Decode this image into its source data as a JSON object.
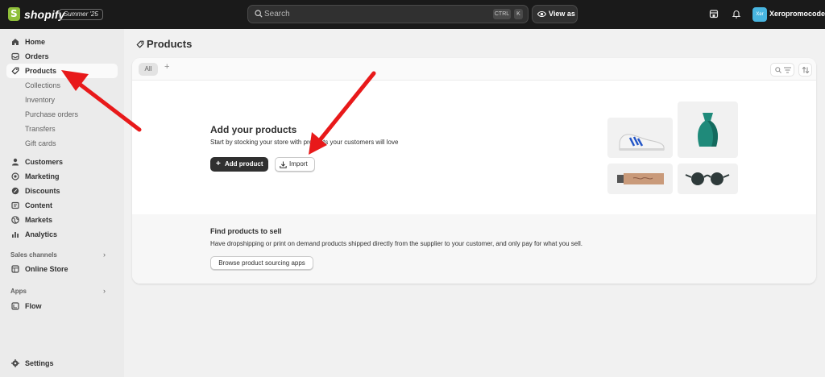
{
  "topbar": {
    "brand": "shopify",
    "edition_badge": "Summer '25",
    "search_placeholder": "Search",
    "shortcut_ctrl": "CTRL",
    "shortcut_k": "K",
    "view_as": "View as",
    "avatar_initials": "Xer",
    "store_name": "Xeropromocode",
    "avatar_color": "#48b5e0"
  },
  "sidebar": {
    "items": [
      {
        "label": "Home",
        "icon": "home-icon"
      },
      {
        "label": "Orders",
        "icon": "inbox-icon"
      },
      {
        "label": "Products",
        "icon": "tag-icon",
        "active": true
      }
    ],
    "product_subitems": [
      "Collections",
      "Inventory",
      "Purchase orders",
      "Transfers",
      "Gift cards"
    ],
    "items2": [
      {
        "label": "Customers",
        "icon": "person-icon"
      },
      {
        "label": "Marketing",
        "icon": "target-icon"
      },
      {
        "label": "Discounts",
        "icon": "discount-icon"
      },
      {
        "label": "Content",
        "icon": "content-icon"
      },
      {
        "label": "Markets",
        "icon": "globe-icon"
      },
      {
        "label": "Analytics",
        "icon": "chart-icon"
      }
    ],
    "sales_channels_label": "Sales channels",
    "online_store": "Online Store",
    "apps_label": "Apps",
    "flow": "Flow",
    "settings": "Settings"
  },
  "main": {
    "page_title": "Products",
    "tab_all": "All",
    "empty_title": "Add your products",
    "empty_desc": "Start by stocking your store with products your customers will love",
    "add_product": "Add product",
    "import": "Import",
    "find_title": "Find products to sell",
    "find_desc": "Have dropshipping or print on demand products shipped directly from the supplier to your customer, and only pay for what you sell.",
    "browse_button": "Browse product sourcing apps"
  },
  "annotation_color": "#e8191a"
}
